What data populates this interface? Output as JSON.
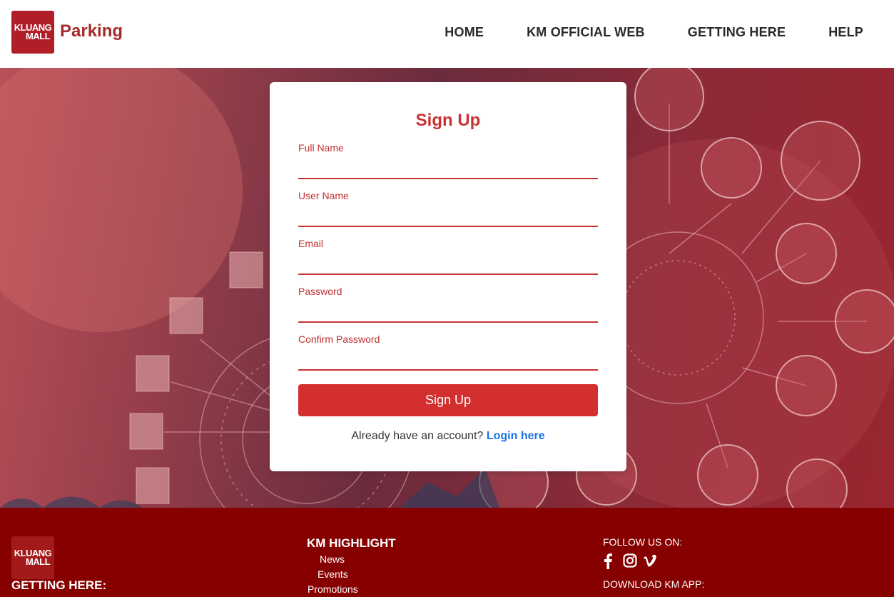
{
  "header": {
    "logo_line1": "KLUANG",
    "logo_line2": "MALL",
    "brand": "Parking",
    "nav": [
      "HOME",
      "KM OFFICIAL WEB",
      "GETTING HERE",
      "HELP"
    ]
  },
  "form": {
    "title": "Sign Up",
    "fields": [
      {
        "label": "Full Name",
        "value": ""
      },
      {
        "label": "User Name",
        "value": ""
      },
      {
        "label": "Email",
        "value": ""
      },
      {
        "label": "Password",
        "value": ""
      },
      {
        "label": "Confirm Password",
        "value": ""
      }
    ],
    "submit_label": "Sign Up",
    "login_prompt": "Already have an account?",
    "login_link": "Login here"
  },
  "footer": {
    "logo_line1": "KLUANG",
    "logo_line2": "MALL",
    "getting_here": "GETTING HERE:",
    "highlight_title": "KM HIGHLIGHT",
    "highlight_links": [
      "News",
      "Events",
      "Promotions"
    ],
    "follow_label": "FOLLOW US ON:",
    "social_icons": [
      "facebook-icon",
      "instagram-icon",
      "vimeo-icon"
    ],
    "download_label": "DOWNLOAD KM APP:"
  },
  "colors": {
    "brand_red": "#d32f2f",
    "footer_bg": "#870000",
    "link_blue": "#1a73e8"
  }
}
